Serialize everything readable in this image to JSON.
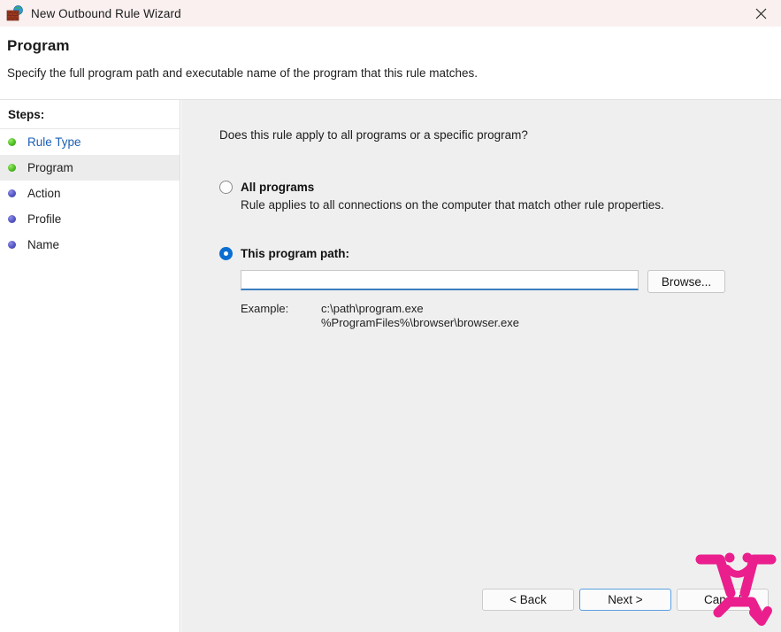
{
  "window": {
    "title": "New Outbound Rule Wizard",
    "icon": "firewall-globe-icon",
    "close_label": "×"
  },
  "header": {
    "title": "Program",
    "subtitle": "Specify the full program path and executable name of the program that this rule matches."
  },
  "sidebar": {
    "heading": "Steps:",
    "items": [
      {
        "label": "Rule Type",
        "state": "done",
        "link": true
      },
      {
        "label": "Program",
        "state": "done",
        "link": false,
        "current": true
      },
      {
        "label": "Action",
        "state": "pending",
        "link": false
      },
      {
        "label": "Profile",
        "state": "pending",
        "link": false
      },
      {
        "label": "Name",
        "state": "pending",
        "link": false
      }
    ]
  },
  "main": {
    "question": "Does this rule apply to all programs or a specific program?",
    "options": [
      {
        "label": "All programs",
        "description": "Rule applies to all connections on the computer that match other rule properties.",
        "selected": false
      },
      {
        "label": "This program path:",
        "selected": true
      }
    ],
    "path_input": {
      "value": "",
      "placeholder": ""
    },
    "browse_label": "Browse...",
    "example": {
      "label": "Example:",
      "values": [
        "c:\\path\\program.exe",
        "%ProgramFiles%\\browser\\browser.exe"
      ]
    }
  },
  "footer": {
    "back_label": "< Back",
    "next_label": "Next >",
    "cancel_label": "Cancel"
  },
  "colors": {
    "titlebar_bg": "#faf0f0",
    "content_bg": "#efefef",
    "sidebar_bg": "#ffffff",
    "link": "#1a5fb4",
    "accent": "#0a6ed1",
    "step_done": "#55c42a",
    "step_pending": "#5a5ac6",
    "doodle": "#ea1e8c",
    "default_button_border": "#5aa0e0"
  }
}
